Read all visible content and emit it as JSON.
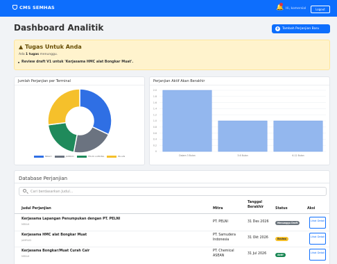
{
  "app": {
    "brand": "CMS SEMHAS",
    "greeting": "Hi, komersial",
    "logout": "Logout"
  },
  "page": {
    "title": "Dashboard Analitik",
    "add_button": "Tambah Perjanjian Baru"
  },
  "alert": {
    "title": "Tugas Untuk Anda",
    "subtitle_prefix": "Ada ",
    "subtitle_bold": "1 tugas",
    "subtitle_suffix": " menunggu.",
    "item": "Review draft V1 untuk 'Kerjasama HMC alat Bongkar Muat'."
  },
  "pie_card": {
    "title": "Jumlah Perjanjian per Terminal"
  },
  "bar_card": {
    "title": "Perjanjian Aktif Akan Berakhir"
  },
  "chart_data": [
    {
      "type": "pie",
      "title": "Jumlah Perjanjian per Terminal",
      "labels": [
        "MIRAH",
        "JAMRUD",
        "TELUK LAMONG",
        "BLLAN"
      ],
      "values": [
        32,
        21,
        20,
        27
      ],
      "colors": [
        "#2f6fe4",
        "#6b7380",
        "#1f8a5b",
        "#f5c02b"
      ]
    },
    {
      "type": "bar",
      "title": "Perjanjian Aktif Akan Berakhir",
      "categories": [
        "Dalam 3 Bulan",
        "3-6 Bulan",
        "6-12 Bulan"
      ],
      "values": [
        2,
        1,
        1
      ],
      "ylim": [
        0,
        2.0
      ],
      "yticks": [
        "0",
        "0.2",
        "0.4",
        "0.6",
        "0.8",
        "1.0",
        "1.2",
        "1.4",
        "1.6",
        "1.8",
        "2.0"
      ],
      "color": "#93b7ee"
    }
  ],
  "table": {
    "section_title": "Database Perjanjian",
    "search_placeholder": "Cari berdasarkan Judul...",
    "headers": {
      "judul": "Judul Perjanjian",
      "mitra": "Mitra",
      "tanggal": "Tanggal Berakhir",
      "status": "Status",
      "aksi": "Aksi"
    },
    "rows": [
      {
        "title": "Kerjasama Lapangan Penumpukan dengan PT. PELNI",
        "terminal": "MIRAH",
        "mitra": "PT. PELNI",
        "date": "31 Des 2026",
        "status": "Menunggu Draft",
        "status_color": "#6c757d",
        "status_text_color": "#ffffff",
        "action": "Lihat Detail"
      },
      {
        "title": "Kerjasama HMC alat Bongkar Muat",
        "terminal": "JAMRUD",
        "mitra": "PT. Samudera Indonesia",
        "date": "31 Okt 2026",
        "status": "Review",
        "status_color": "#f5c02b",
        "status_text_color": "#222222",
        "action": "Lihat Detail"
      },
      {
        "title": "Kerjasama Bongkar/Muat Curah Cair",
        "terminal": "MIRAH",
        "mitra": "PT. Chemical ASEAN",
        "date": "31 Jul 2026",
        "status": "Aktif",
        "status_color": "#198754",
        "status_text_color": "#ffffff",
        "action": "Lihat Detail"
      }
    ]
  }
}
